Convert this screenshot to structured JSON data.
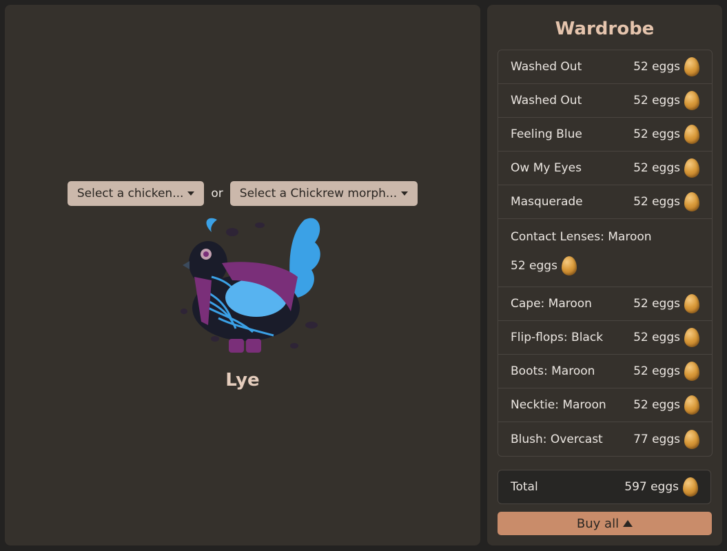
{
  "selectors": {
    "chicken_label": "Select a chicken...",
    "or_label": "or",
    "morph_label": "Select a Chickrew morph..."
  },
  "chicken": {
    "name": "Lye"
  },
  "wardrobe": {
    "title": "Wardrobe",
    "items": [
      {
        "name": "Washed Out",
        "price": "52 eggs"
      },
      {
        "name": "Washed Out",
        "price": "52 eggs"
      },
      {
        "name": "Feeling Blue",
        "price": "52 eggs"
      },
      {
        "name": "Ow My Eyes",
        "price": "52 eggs"
      },
      {
        "name": "Masquerade",
        "price": "52 eggs"
      },
      {
        "name": "Contact Lenses: Maroon",
        "price": "52 eggs"
      },
      {
        "name": "Cape: Maroon",
        "price": "52 eggs"
      },
      {
        "name": "Flip-flops: Black",
        "price": "52 eggs"
      },
      {
        "name": "Boots: Maroon",
        "price": "52 eggs"
      },
      {
        "name": "Necktie: Maroon",
        "price": "52 eggs"
      },
      {
        "name": "Blush: Overcast",
        "price": "77 eggs"
      }
    ],
    "total_label": "Total",
    "total_price": "597 eggs",
    "buy_label": "Buy all"
  },
  "icons": {
    "currency": "egg-icon",
    "buy": "triangle-up-icon",
    "dropdown": "caret-down-icon"
  }
}
